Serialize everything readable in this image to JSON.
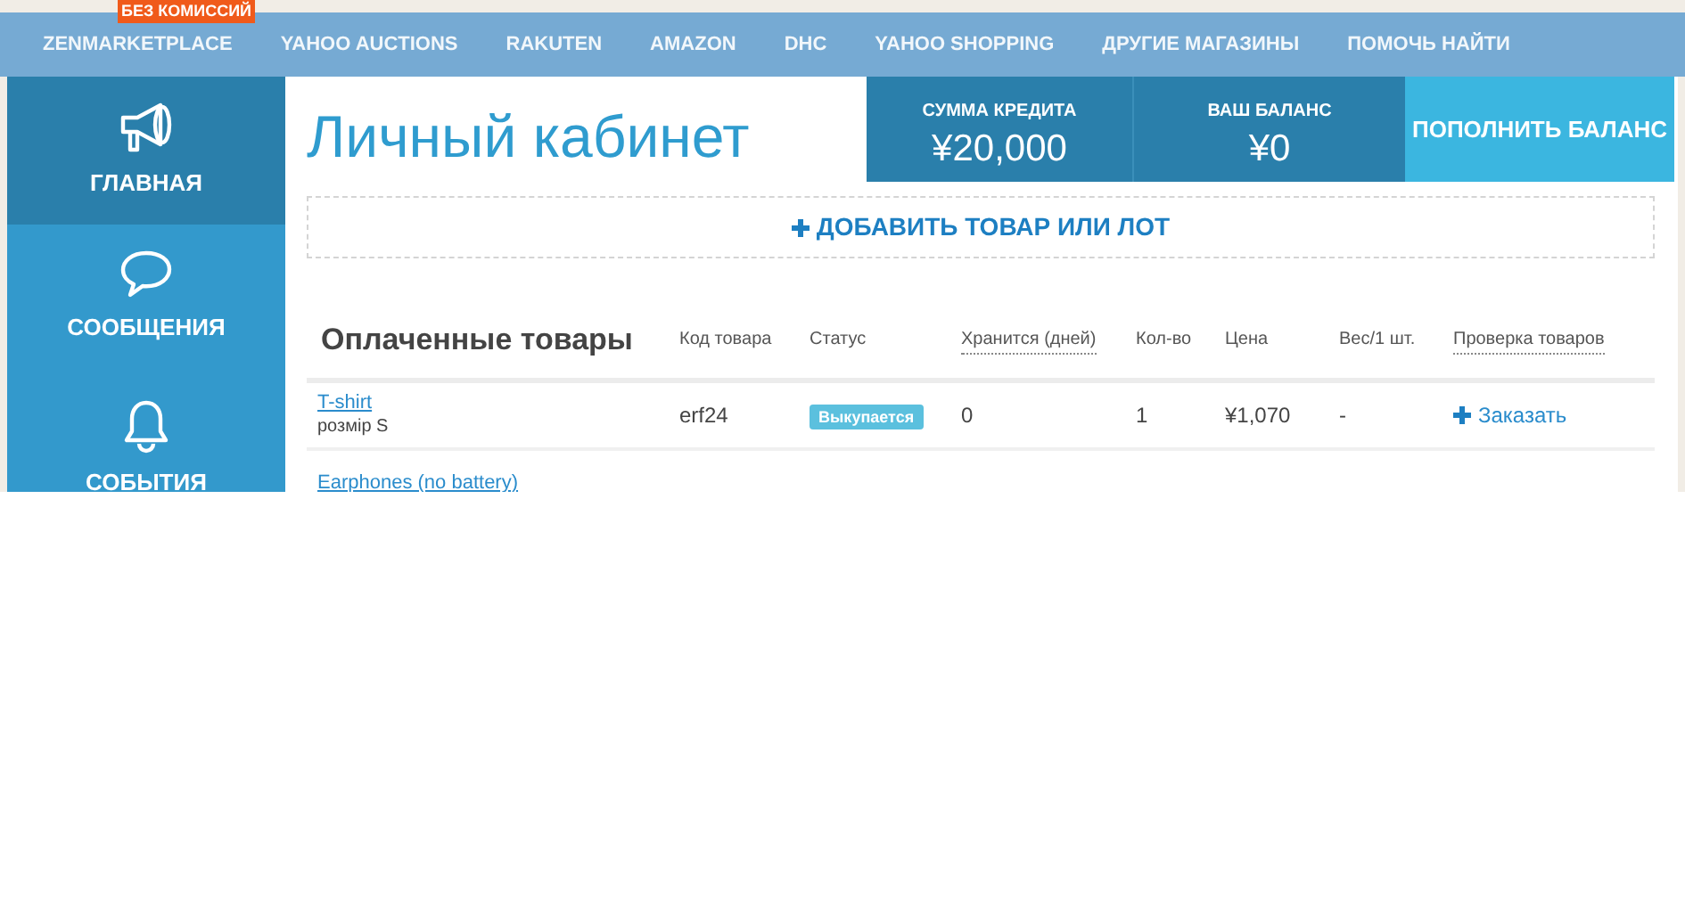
{
  "top_nav": {
    "badge": "БЕЗ КОМИССИЙ",
    "items": [
      "ZENMARKETPLACE",
      "YAHOO AUCTIONS",
      "RAKUTEN",
      "AMAZON",
      "DHC",
      "YAHOO SHOPPING",
      "ДРУГИЕ МАГАЗИНЫ",
      "ПОМОЧЬ НАЙТИ"
    ]
  },
  "sidebar": {
    "items": [
      {
        "label": "ГЛАВНАЯ",
        "kind": "megaphone",
        "selected": true
      },
      {
        "label": "СООБЩЕНИЯ",
        "kind": "chat",
        "selected": false
      },
      {
        "label": "СОБЫТИЯ",
        "kind": "bell",
        "selected": false
      }
    ]
  },
  "page_title": "Личный кабинет",
  "credit": {
    "label": "СУММА КРЕДИТА",
    "value": "¥20,000"
  },
  "balance": {
    "label": "ВАШ БАЛАНС",
    "value": "¥0"
  },
  "top_up_button": "ПОПОЛНИТЬ БАЛАНС",
  "add_item_button": "ДОБАВИТЬ ТОВАР ИЛИ ЛОТ",
  "table": {
    "title": "Оплаченные товары",
    "columns": [
      {
        "label": "Код товара",
        "dotted": false
      },
      {
        "label": "Статус",
        "dotted": false
      },
      {
        "label": "Хранится (дней)",
        "dotted": true
      },
      {
        "label": "Кол-во",
        "dotted": false
      },
      {
        "label": "Цена",
        "dotted": false
      },
      {
        "label": "Вес/1 шт.",
        "dotted": false
      },
      {
        "label": "Проверка товаров",
        "dotted": true
      }
    ],
    "rows": [
      {
        "name": "T-shirt",
        "detail": "розмір S",
        "code": "erf24",
        "status": "Выкупается",
        "stored": "0",
        "qty": "1",
        "price": "¥1,070",
        "weight": "-",
        "action": "Заказать"
      },
      {
        "name": "Earphones (no battery)"
      }
    ]
  }
}
